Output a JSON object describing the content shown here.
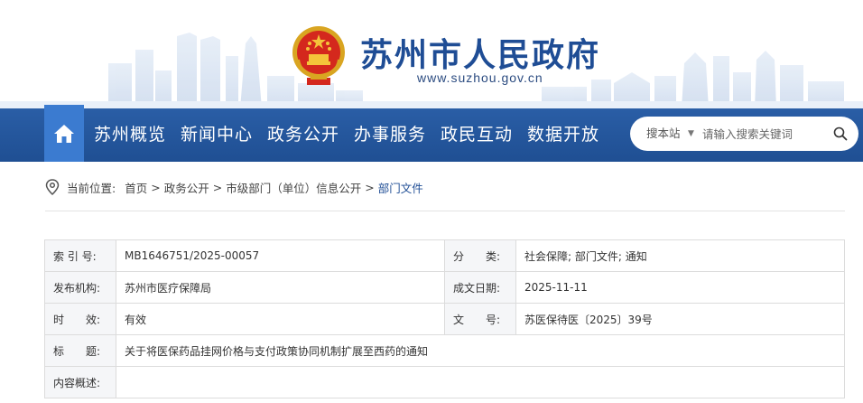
{
  "site": {
    "title": "苏州市人民政府",
    "url": "www.suzhou.gov.cn"
  },
  "nav": {
    "items": [
      {
        "label": "苏州概览"
      },
      {
        "label": "新闻中心"
      },
      {
        "label": "政务公开"
      },
      {
        "label": "办事服务"
      },
      {
        "label": "政民互动"
      },
      {
        "label": "数据开放"
      }
    ]
  },
  "search": {
    "scope": "搜本站",
    "placeholder": "请输入搜索关键词"
  },
  "breadcrumb": {
    "prefix": "当前位置:",
    "items": [
      "首页",
      "政务公开",
      "市级部门（单位）信息公开",
      "部门文件"
    ],
    "separator": ">"
  },
  "info": {
    "index_label": "索 引 号:",
    "index_value": "MB1646751/2025-00057",
    "category_label": "分　　类:",
    "category_value": "社会保障;  部门文件;  通知",
    "publisher_label": "发布机构:",
    "publisher_value": "苏州市医疗保障局",
    "date_label": "成文日期:",
    "date_value": "2025-11-11",
    "validity_label": "时　　效:",
    "validity_value": "有效",
    "docno_label": "文　　号:",
    "docno_value": "苏医保待医〔2025〕39号",
    "title_label": "标　　题:",
    "title_value": "关于将医保药品挂网价格与支付政策协同机制扩展至西药的通知",
    "summary_label": "内容概述:",
    "summary_value": ""
  }
}
